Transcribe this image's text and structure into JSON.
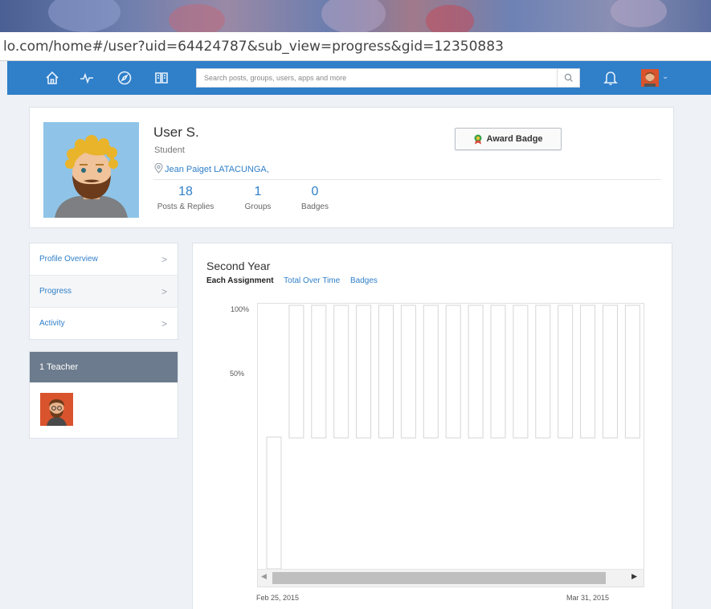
{
  "browser": {
    "url": "lo.com/home#/user?uid=64424787&sub_view=progress&gid=12350883"
  },
  "nav": {
    "icons": [
      "home-icon",
      "activity-icon",
      "discover-icon",
      "library-icon"
    ],
    "search_placeholder": "Search posts, groups, users, apps and more",
    "accent": "#2f7fc9"
  },
  "profile": {
    "name": "User S.",
    "role": "Student",
    "school": "Jean Paiget LATACUNGA,",
    "award_label": "Award Badge",
    "stats": [
      {
        "value": "18",
        "label": "Posts & Replies"
      },
      {
        "value": "1",
        "label": "Groups"
      },
      {
        "value": "0",
        "label": "Badges"
      }
    ]
  },
  "side_menu": {
    "items": [
      {
        "label": "Profile Overview",
        "chevron": ">"
      },
      {
        "label": "Progress",
        "chevron": ">"
      },
      {
        "label": "Activity",
        "chevron": ">"
      }
    ],
    "active": "Progress"
  },
  "teachers": {
    "header": "1 Teacher"
  },
  "progress": {
    "title": "Second Year",
    "tabs": [
      "Each Assignment",
      "Total Over Time",
      "Badges"
    ],
    "active_tab": "Each Assignment"
  },
  "chart_data": {
    "type": "bar",
    "title": "",
    "xlabel": "",
    "ylabel": "",
    "ylim": [
      0,
      100
    ],
    "y_ticks": [
      "100%",
      "50%"
    ],
    "x_range_labels": [
      "Feb 25, 2015",
      "Mar 31, 2015"
    ],
    "series": [
      {
        "values": [
          50,
          100,
          100,
          100,
          100,
          100,
          100,
          100,
          100,
          100,
          100,
          100,
          100,
          100,
          100,
          100,
          100,
          100
        ]
      }
    ],
    "grid": false,
    "scrollbar": true
  }
}
